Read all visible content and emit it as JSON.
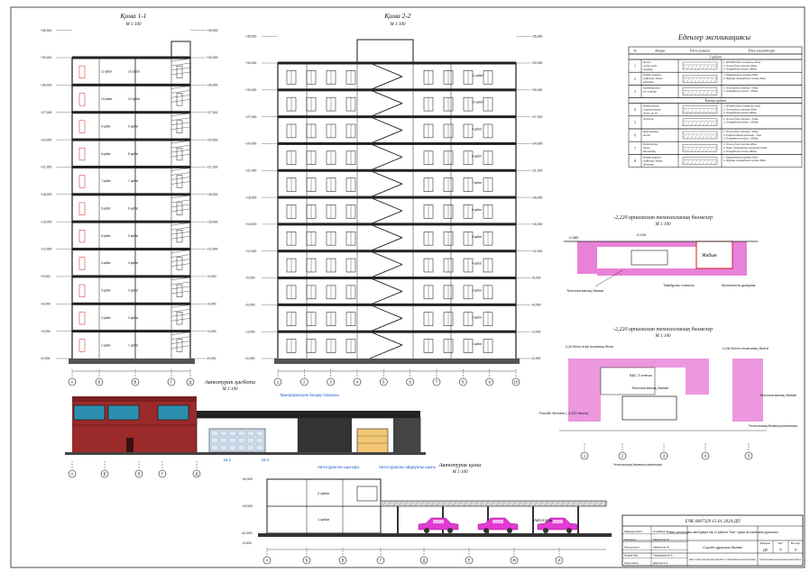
{
  "titles": {
    "section_1_1": "Қима 1-1",
    "section_1_1_scale": "М 1:100",
    "section_2_2": "Қима 2-2",
    "section_2_2_scale": "М 1:100",
    "parking_facade": "Автотурак ҳасбети",
    "parking_facade_scale": "М 1:100",
    "parking_section": "Автотурак қима",
    "parking_section_scale": "М 1:100",
    "node1": "-2,220 арналаскан технологиялиқ бөлмелер",
    "node1_scale": "М 1:100",
    "node2": "-2,220 арналаскан технологиялиқ бөлмелер",
    "node2_scale": "М 1:100"
  },
  "floor_labels": [
    "1 қабат",
    "2 қабат",
    "3 қабат",
    "4 қабат",
    "5 қабат",
    "6 қабат",
    "7 қабат",
    "8 қабат",
    "9 қабат",
    "10 қабат",
    "11 қабат"
  ],
  "floor_marks": [
    "±0,000",
    "+3,000",
    "+6,000",
    "+9,000",
    "+12,000",
    "+15,000",
    "+18,000",
    "+21,000",
    "+24,000",
    "+27,000",
    "+30,000",
    "+33,000",
    "+35,900"
  ],
  "axes_1_1": [
    "А",
    "Б",
    "В",
    "Г",
    "Д"
  ],
  "axes_2_2": [
    "1",
    "2",
    "3",
    "4",
    "5",
    "6",
    "7",
    "8",
    "9",
    "10"
  ],
  "axes_facade": [
    "А",
    "Б",
    "В",
    "Г",
    "Д"
  ],
  "axes_parking": [
    "А",
    "Б",
    "В",
    "Г",
    "Д",
    "Е",
    "Ж",
    "И"
  ],
  "axes_node2": [
    "1",
    "2",
    "3",
    "4",
    "5"
  ],
  "explication": {
    "title": "Еденлер экспликациясы",
    "headers": [
      "№",
      "Атауы",
      "Еден схемасы",
      "Еден элементлери"
    ],
    "groups": [
      {
        "name": "1 қабат",
        "rows": [
          {
            "n": "1",
            "name": "Дәлиз, жуўа-жай, тамбур",
            "elements": [
              "1. 600х600 еден плиткасы-20мм",
              "2. Тегислеўши стяжка-40мм",
              "3. Темирбетон плита-180мм"
            ]
          },
          {
            "n": "2",
            "name": "Қойма қаралы, лифтлер, бөлме абоктор",
            "elements": [
              "1. Керамикалық плитка-20мм",
              "2. Жуўаны темирбетон плита-30мм"
            ]
          },
          {
            "n": "3",
            "name": "Коммуналлық уй-жайлар",
            "elements": [
              "1. Тегислеўши стяжка - 60мм",
              "2. Темирбетон плита - 180мм"
            ]
          }
        ]
      },
      {
        "name": "Типлик қабат",
        "rows": [
          {
            "n": "4",
            "name": "Қонақ бөлме, жатын бөлме, дәлиз, ас үй",
            "elements": [
              "1. 600х600 еден плиткасы-20мм",
              "2. Тегислеўши стяжка-40мм",
              "3. Темирбетон плита-180мм"
            ]
          },
          {
            "n": "5",
            "name": "Лоджия",
            "elements": [
              "1. Тегислеўши стяжка - 45мм",
              "2. Темирбетон плита - 180мм"
            ]
          },
          {
            "n": "6",
            "name": "Жуўынатын бөлме",
            "elements": [
              "1. Тегислеўши стяжка - 40мм",
              "2. Гидроизоляция қатлами - 5мм",
              "3. Темирбетон плита - 180мм"
            ]
          },
          {
            "n": "7",
            "name": "Подъездлер, дәлиз, баспалдақ тордагы, холл",
            "elements": [
              "1. Тегислеўши стяжка-40мм",
              "2. Жылу изоляциялық материал-20мм",
              "3. Темирбетон плита-180мм"
            ]
          },
          {
            "n": "8",
            "name": "Қойма қаралы, лифтлер, бөлме абоктор",
            "elements": [
              "1. Керамикалық плитка-20мм",
              "2. Жуўаны темирбетон плита-30мм"
            ]
          }
        ]
      }
    ]
  },
  "facade_labels": {
    "glass": "Трансформаторлы басқару станциясы",
    "exit": "Автотурактан шығыўы",
    "entry": "Автотурақтан айдаўалы шығы",
    "mark1": "Ш-1",
    "mark2": "Ш-2"
  },
  "node1_labels": {
    "left_mark": "-0,380",
    "top_mark": "-0,100",
    "red": "Жабын",
    "a": "Технологиялық бөлме",
    "b": "Тамбурлы тоннель",
    "c": "Монолитли диаграм"
  },
  "node2_labels": {
    "a": "-0,26 бетон өтиў тесигиниң белги",
    "b": "-0,26 бетон тесигиниң белги",
    "c": "ВБС 3 клетка",
    "d": "Технологиялық бөлме",
    "e": "Технологиялық бөлме",
    "f": "Рисобе белгиси (-2,220 белги)",
    "g": "Технологиялық бөлмениң есикленлери",
    "h": "Технологиялық бөлмениң есикленлери"
  },
  "parking_section_labels": {
    "floor2": "2 қабат",
    "floor1": "1 қабат",
    "zone": "Автотурақ",
    "mark_top": "+6,000",
    "mark_mid": "+3,000",
    "mark_zero": "±0,000",
    "mark_bottom": "-3,000"
  },
  "stamp": {
    "code": "ЕЧК 6807329 15-01 2024-ДП",
    "project": "«Нөкис қаласындағы автотурақлы бир 12 қабатлы \"Елат\" турғын үй комплексин қурылысы»",
    "stage_header": [
      "Басқыш",
      "Бет",
      "Бетлер"
    ],
    "stage": [
      "ДК",
      "5",
      "9"
    ],
    "sheet1": "Сәулет-қурылыс бөлим",
    "sheet2": "Қима 1-1, қима 2-2, автотурақ ҳасбети қима қима 2-2, -2,220 арналаскан технологиялиқ бөлмелер",
    "org": "ҚҚ Нөкис мәмлекетлик университети, Кураўшылық және кураўлы қурылыс кафедрасы 1-ДКЖ-20 топар",
    "roles": [
      "Кафедра басл.",
      "Жетекши",
      "Консультант",
      "Норма бақ.",
      "Орынлаған"
    ],
    "names": [
      "Атамбаев Т.",
      "Мамбетов Ж.",
      "Мамбетов Ж.",
      "Тажимуратов А.",
      "Дауленов А."
    ]
  },
  "colors": {
    "line": "#1a1a1a",
    "magenta": "#d51ab8",
    "red": "#d21d1d",
    "blue": "#1a56c8",
    "brick": "#9b2a2a",
    "dark": "#2f2f2f"
  }
}
